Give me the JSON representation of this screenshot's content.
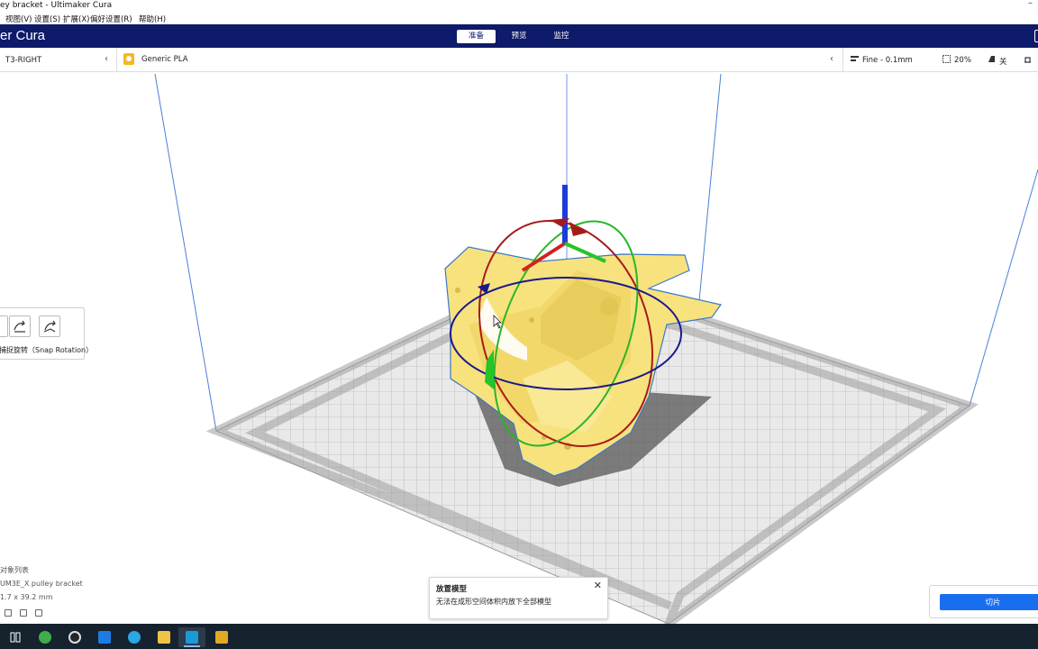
{
  "window": {
    "title": "ey bracket - Ultimaker Cura",
    "minimize_glyph": "–"
  },
  "menubar": {
    "items": [
      "视图(V)",
      "设置(S)",
      "扩展(X)",
      "偏好设置(R)",
      "帮助(H)"
    ]
  },
  "header": {
    "logo": "er Cura",
    "stages": [
      {
        "label": "准备",
        "active": true
      },
      {
        "label": "预览",
        "active": false
      },
      {
        "label": "监控",
        "active": false
      }
    ]
  },
  "printer": {
    "name": "T3-RIGHT",
    "chevron": "‹"
  },
  "material": {
    "name": "Generic PLA",
    "chevron": "‹"
  },
  "print_settings": {
    "profile": "Fine - 0.1mm",
    "infill": "20%",
    "support": "关",
    "adhesion_icon": "adhesion-icon"
  },
  "rotate_tool": {
    "snap_label": "捕捉旋转（Snap Rotation）"
  },
  "object_list": {
    "header": "对象列表",
    "object_name": "UM3E_X pulley bracket",
    "dimensions": "1.7 x 39.2 mm"
  },
  "toast": {
    "title": "放置模型",
    "body": "无法在成形空间体积内放下全部模型",
    "close_glyph": "✕"
  },
  "slice": {
    "label": "切片"
  },
  "taskbar": {
    "icons": [
      "task-view-icon",
      "chrome-icon",
      "obs-icon",
      "app-icon",
      "edge-icon",
      "folder-icon",
      "cura-icon",
      "media-player-icon"
    ]
  },
  "colors": {
    "header_bg": "#0e1a6a",
    "accent": "#196ef0",
    "model": "#f7e27e",
    "taskbar": "#16222e"
  }
}
